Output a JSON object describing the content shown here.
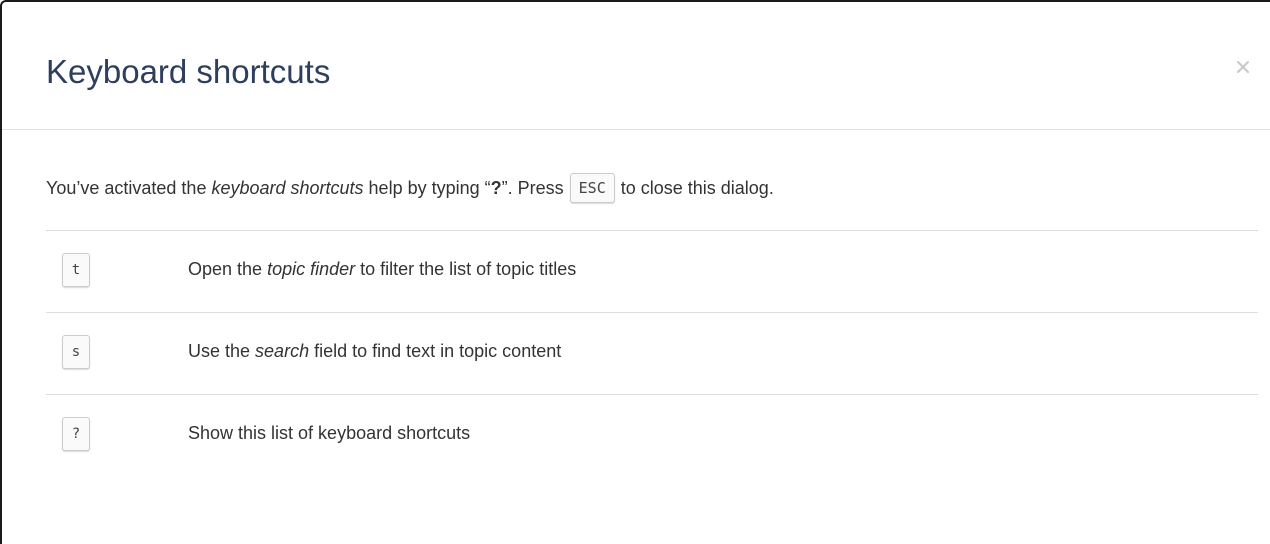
{
  "dialog": {
    "title": "Keyboard shortcuts",
    "close_icon": "close-icon"
  },
  "intro": {
    "part1": "You’ve activated the ",
    "part2_italic": "keyboard shortcuts",
    "part3": " help by typing “",
    "part4_bold": "?",
    "part5": "”. Press",
    "key": "ESC",
    "part6": "to close this dialog."
  },
  "shortcuts": [
    {
      "key": "t",
      "desc_prefix": "Open the ",
      "desc_italic": "topic finder",
      "desc_suffix": " to filter the list of topic titles"
    },
    {
      "key": "s",
      "desc_prefix": "Use the ",
      "desc_italic": "search",
      "desc_suffix": " field to find text in topic content"
    },
    {
      "key": "?",
      "desc_prefix": "Show this list of keyboard shortcuts",
      "desc_italic": "",
      "desc_suffix": ""
    }
  ],
  "colors": {
    "title": "#2d3e5e",
    "text": "#333333",
    "divider": "#dddddd",
    "close": "#c8c8c8"
  }
}
